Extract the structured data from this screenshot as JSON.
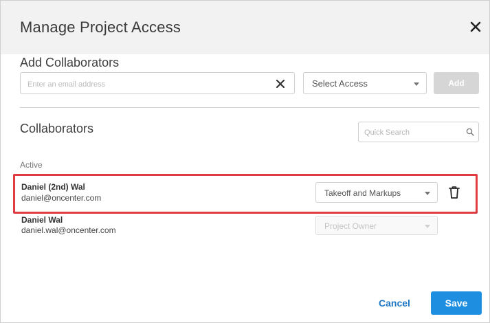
{
  "dialog": {
    "title": "Manage Project Access",
    "close_icon": "close-icon"
  },
  "add_collaborators": {
    "heading": "Add Collaborators",
    "email_placeholder": "Enter an email address",
    "email_value": "",
    "clear_icon": "clear-icon",
    "access_select_label": "Select Access",
    "add_label": "Add"
  },
  "collaborators": {
    "heading": "Collaborators",
    "search_placeholder": "Quick Search",
    "search_icon": "search-icon",
    "active_label": "Active",
    "rows": [
      {
        "name": "Daniel (2nd) Wal",
        "email": "daniel@oncenter.com",
        "access": "Takeoff and Markups",
        "highlighted": true,
        "deletable": true
      },
      {
        "name": "Daniel Wal",
        "email": "daniel.wal@oncenter.com",
        "access": "Project Owner",
        "highlighted": false,
        "deletable": false
      }
    ]
  },
  "footer": {
    "cancel_label": "Cancel",
    "save_label": "Save"
  },
  "colors": {
    "primary": "#1e8ee0",
    "link": "#1f78c5",
    "highlight": "#e03a42",
    "header_bg": "#f2f2f2"
  }
}
